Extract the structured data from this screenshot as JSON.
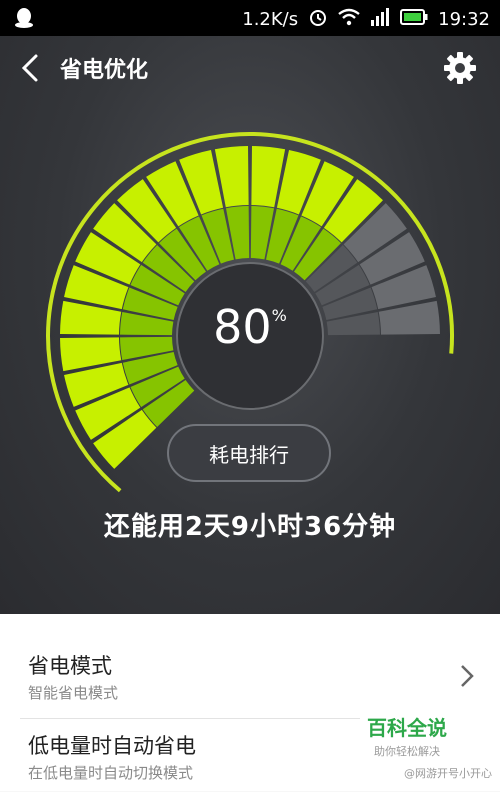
{
  "status_bar": {
    "speed": "1.2K/s",
    "time": "19:32",
    "icons": [
      "qq-icon",
      "alarm-icon",
      "wifi-icon",
      "signal-icon",
      "battery-icon"
    ]
  },
  "header": {
    "title": "省电优化"
  },
  "gauge": {
    "percent": "80",
    "percent_unit": "%",
    "level": 0.8,
    "colors": {
      "active_outer": "#c7f000",
      "active_inner": "#86c400",
      "inactive_outer": "#6a6c70",
      "inactive_inner": "#55575b",
      "ring": "#c7e41e"
    }
  },
  "rank_button": {
    "label": "耗电排行"
  },
  "remaining_text": "还能用2天9小时36分钟",
  "list": {
    "items": [
      {
        "title": "省电模式",
        "subtitle": "智能省电模式"
      },
      {
        "title": "低电量时自动省电",
        "subtitle": "在低电量时自动切换模式"
      }
    ]
  },
  "watermark": {
    "main": "百科全说",
    "sub": "助你轻松解决",
    "footer": "@网游开号小开心"
  }
}
